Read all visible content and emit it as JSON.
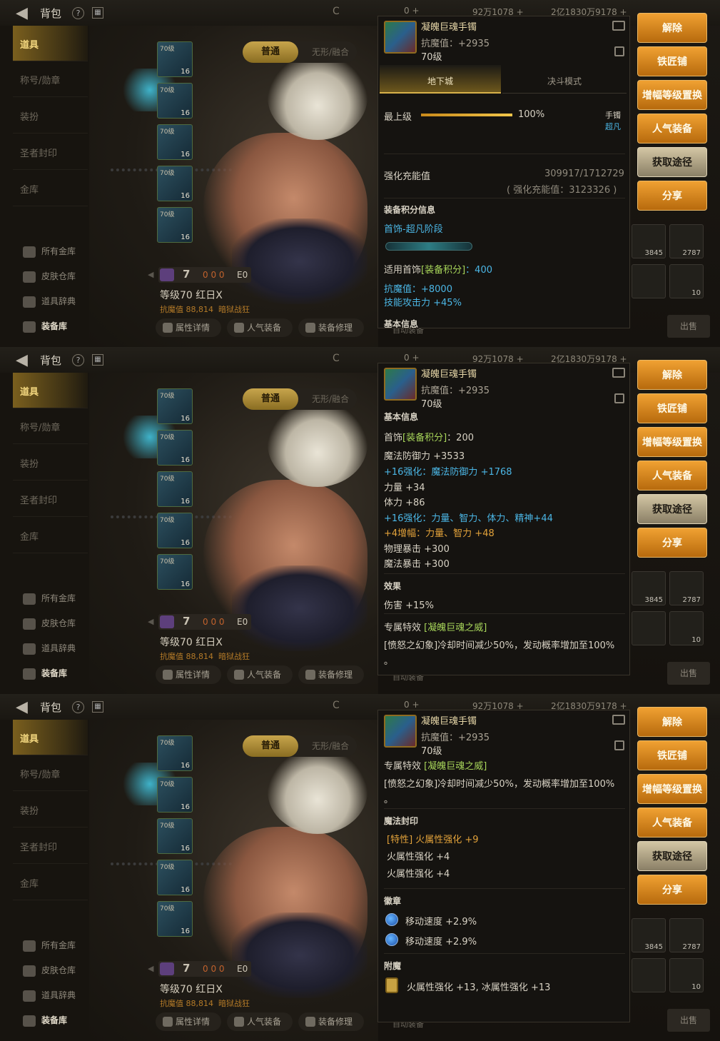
{
  "header": {
    "back_icon": "◀",
    "title": "背包",
    "help_icon": "?",
    "calendar_icon": "▦",
    "coin_icon": "C",
    "cur1": "0 +",
    "cur2": "92万1078 +",
    "cur3": "2亿1830万9178 +"
  },
  "sidebar": {
    "items": [
      "道具",
      "称号/勋章",
      "装扮",
      "圣者封印",
      "金库"
    ],
    "sub": [
      "所有金库",
      "皮肤仓库",
      "道具辞典",
      "装备库"
    ]
  },
  "character": {
    "tab_normal": "普通",
    "tab_fuse": "无形/融合",
    "slot_level": "70级",
    "slot_values": [
      "16",
      "16",
      "16",
      "16",
      "16"
    ],
    "stat_main": "7",
    "stat_dots": "0 0 0",
    "stat_e": "E0",
    "level_name": "等级70 红日X",
    "magic_res": "抗魔值 88,814",
    "magic_mode": "暗狱战狂",
    "buttons": [
      "属性详情",
      "人气装备",
      "装备修理"
    ],
    "more": "自动装备"
  },
  "right_buttons": [
    "解除",
    "铁匠铺",
    "增幅等级置换",
    "人气装备",
    "获取途径",
    "分享"
  ],
  "inventory": {
    "slots": [
      "3845",
      "2787",
      "",
      "10"
    ],
    "sell": "出售"
  },
  "tooltip": {
    "name": "凝魄巨魂手镯",
    "resist": "抗魔值：+2935",
    "level": "70级",
    "mode_a": "地下城",
    "mode_b": "决斗模式",
    "grade_label": "最上级",
    "grade_value": "100%",
    "slot_type": "手镯",
    "slot_grade": "超凡",
    "charge_label": "强化充能值",
    "charge_value": "309917/1712729",
    "charge_sub": "( 强化充能值：3123326 )",
    "score_title": "装备积分信息",
    "score_stage": "首饰-超凡阶段",
    "score_line_a": "适用首饰",
    "score_line_b": "[装备积分]",
    "score_line_c": "：400",
    "score_bonus1": "抗魔值：+8000",
    "score_bonus2": "技能攻击力 +45%",
    "base_title": "基本信息",
    "base_score_a": "首饰",
    "base_score_b": "[装备积分]",
    "base_score_c": "：200",
    "stats": [
      {
        "text": "魔法防御力 +3533",
        "color": "white"
      },
      {
        "text": "+16强化：魔法防御力 +1768",
        "color": "blue"
      },
      {
        "text": "力量 +34",
        "color": "white"
      },
      {
        "text": "体力 +86",
        "color": "white"
      },
      {
        "text": "+16强化：力量、智力、体力、精神+44",
        "color": "blue"
      },
      {
        "text": "+4增幅：力量、智力 +48",
        "color": "gold"
      },
      {
        "text": "物理暴击 +300",
        "color": "white"
      },
      {
        "text": "魔法暴击 +300",
        "color": "white"
      }
    ],
    "effect_title": "效果",
    "effect_value": "伤害 +15%",
    "special_a": "专属特效",
    "special_b": "[凝魄巨魂之威]",
    "special_desc": "[愤怒之幻象]冷却时间减少50%，发动概率增加至100%",
    "special_tail": "。",
    "seal_title": "魔法封印",
    "seal_lines": [
      "[特性] 火属性强化 +9",
      "火属性强化 +4",
      "火属性强化 +4"
    ],
    "emblem_title": "徽章",
    "emblems": [
      "移动速度 +2.9%",
      "移动速度 +2.9%"
    ],
    "enchant_title": "附魔",
    "enchant": "火属性强化 +13, 冰属性强化 +13",
    "cut_title": "基本信息"
  },
  "colors": {
    "accent": "#f0a132",
    "tooltip_bg": "#161411",
    "highlight_blue": "#4bb6e5"
  }
}
